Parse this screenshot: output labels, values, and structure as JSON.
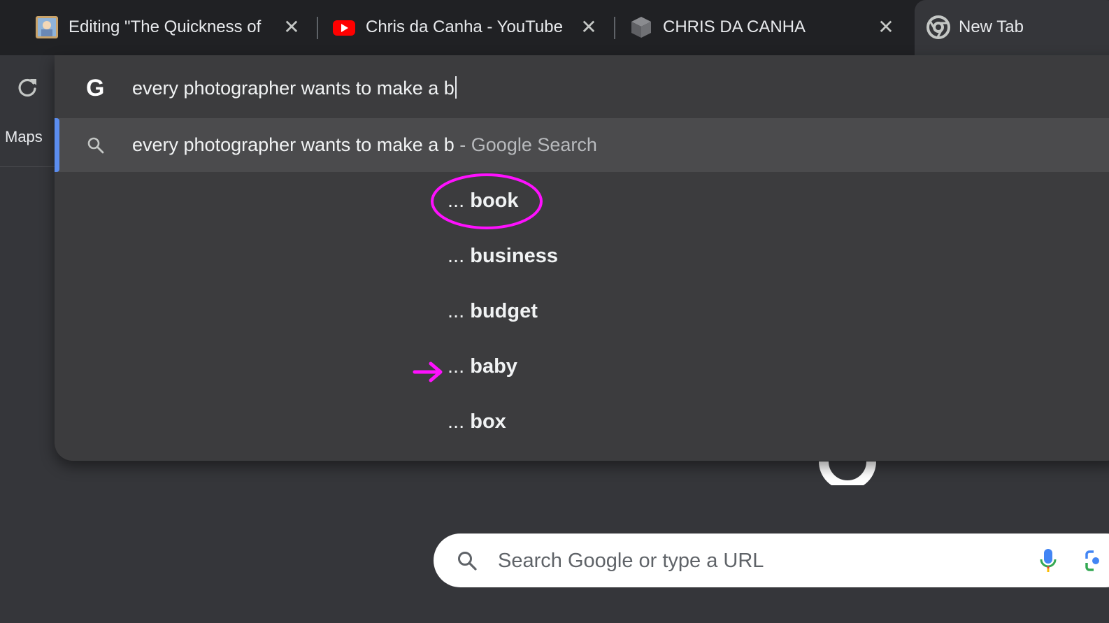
{
  "tabs": [
    {
      "title": "Editing \"The Quickness of",
      "favicon": "thumbnail-image-icon"
    },
    {
      "title": "Chris da Canha - YouTube",
      "favicon": "youtube-icon"
    },
    {
      "title": "CHRIS DA CANHA",
      "favicon": "cube-icon"
    },
    {
      "title": "New Tab",
      "favicon": "chrome-icon"
    }
  ],
  "toolbar": {
    "maps_label": "Maps"
  },
  "omnibox": {
    "input_value": "every photographer wants to make a b",
    "selected_suggestion": {
      "query": "every photographer wants to make a b",
      "hint": "- Google Search"
    },
    "tail_prefix": "...",
    "tail_suggestions": [
      "book",
      "business",
      "budget",
      "baby",
      "box"
    ]
  },
  "ntp": {
    "search_placeholder": "Search Google or type a URL"
  },
  "colors": {
    "annotation": "#ff10ff",
    "selection_bar": "#5b8def",
    "popup_bg": "#3c3c3e"
  }
}
